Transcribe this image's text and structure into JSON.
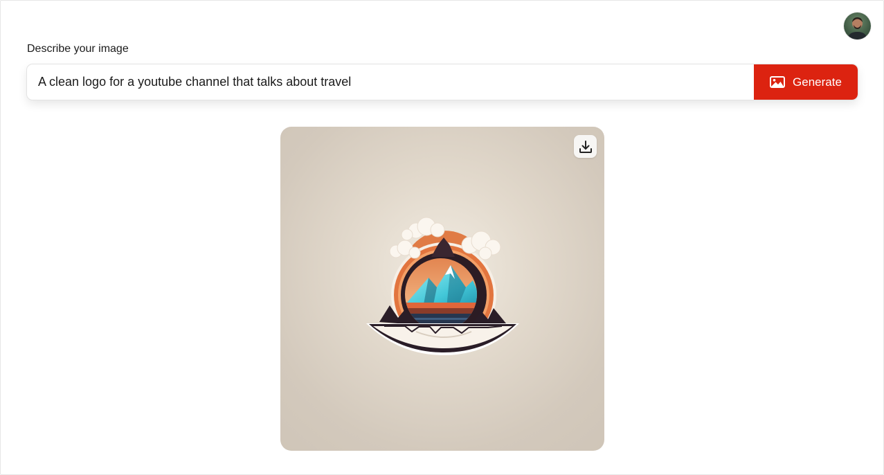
{
  "header": {
    "avatar_icon": "user-avatar"
  },
  "prompt": {
    "label": "Describe your image",
    "value": "A clean logo for a youtube channel that talks about travel",
    "generate_label": "Generate",
    "generate_icon": "image-icon"
  },
  "result": {
    "download_icon": "download-icon",
    "image_subject": "mountain-travel-logo"
  },
  "colors": {
    "accent": "#dc2310",
    "card_background": "#d9cfc2"
  }
}
